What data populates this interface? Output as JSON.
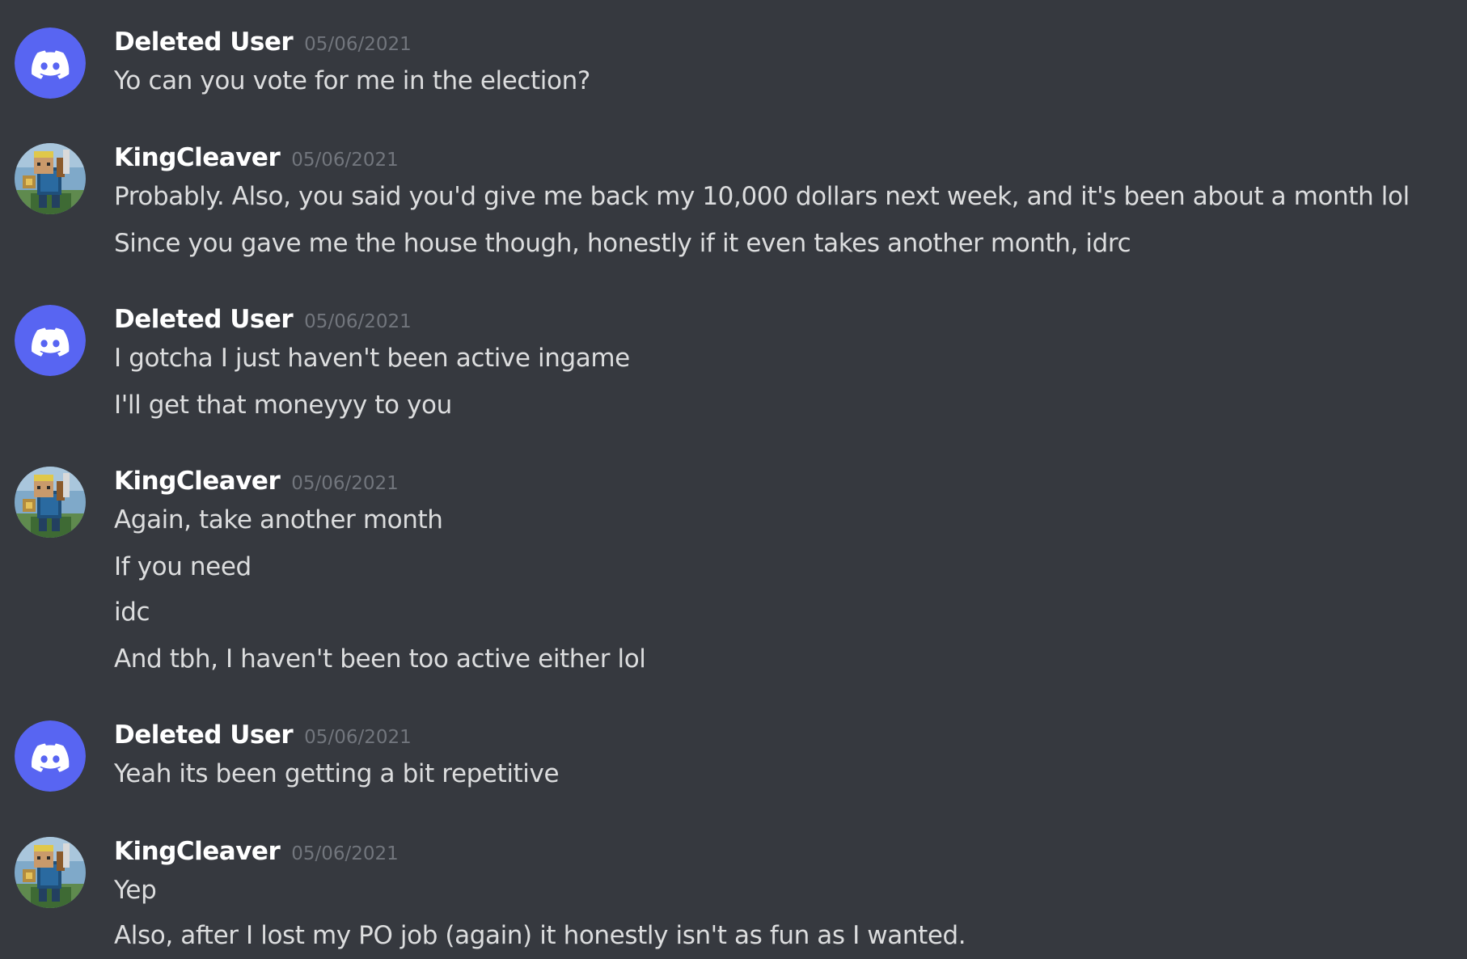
{
  "colors": {
    "background": "#36393f",
    "discord_blurple": "#5865f2",
    "username": "#ffffff",
    "timestamp": "#72767d",
    "message_text": "#dcddde"
  },
  "messages": [
    {
      "author": "Deleted User",
      "avatar": "discord-logo-icon",
      "timestamp": "05/06/2021",
      "lines": [
        "Yo can you vote for me in the election?"
      ]
    },
    {
      "author": "KingCleaver",
      "avatar": "minecraft-skin-avatar",
      "timestamp": "05/06/2021",
      "lines": [
        "Probably. Also, you said you'd give me back my 10,000 dollars next week, and it's been about a month lol",
        "Since you gave me the house though, honestly if it even takes another month, idrc"
      ]
    },
    {
      "author": "Deleted User",
      "avatar": "discord-logo-icon",
      "timestamp": "05/06/2021",
      "lines": [
        "I gotcha I just haven't been active ingame",
        "I'll get that moneyyy to you"
      ]
    },
    {
      "author": "KingCleaver",
      "avatar": "minecraft-skin-avatar",
      "timestamp": "05/06/2021",
      "lines": [
        "Again, take another month",
        "If you need",
        "idc",
        "And tbh, I haven't been too active either lol"
      ]
    },
    {
      "author": "Deleted User",
      "avatar": "discord-logo-icon",
      "timestamp": "05/06/2021",
      "lines": [
        "Yeah its been getting a bit repetitive"
      ]
    },
    {
      "author": "KingCleaver",
      "avatar": "minecraft-skin-avatar",
      "timestamp": "05/06/2021",
      "lines": [
        "Yep",
        "Also, after I lost my PO job (again) it honestly isn't as fun as I wanted."
      ]
    }
  ]
}
